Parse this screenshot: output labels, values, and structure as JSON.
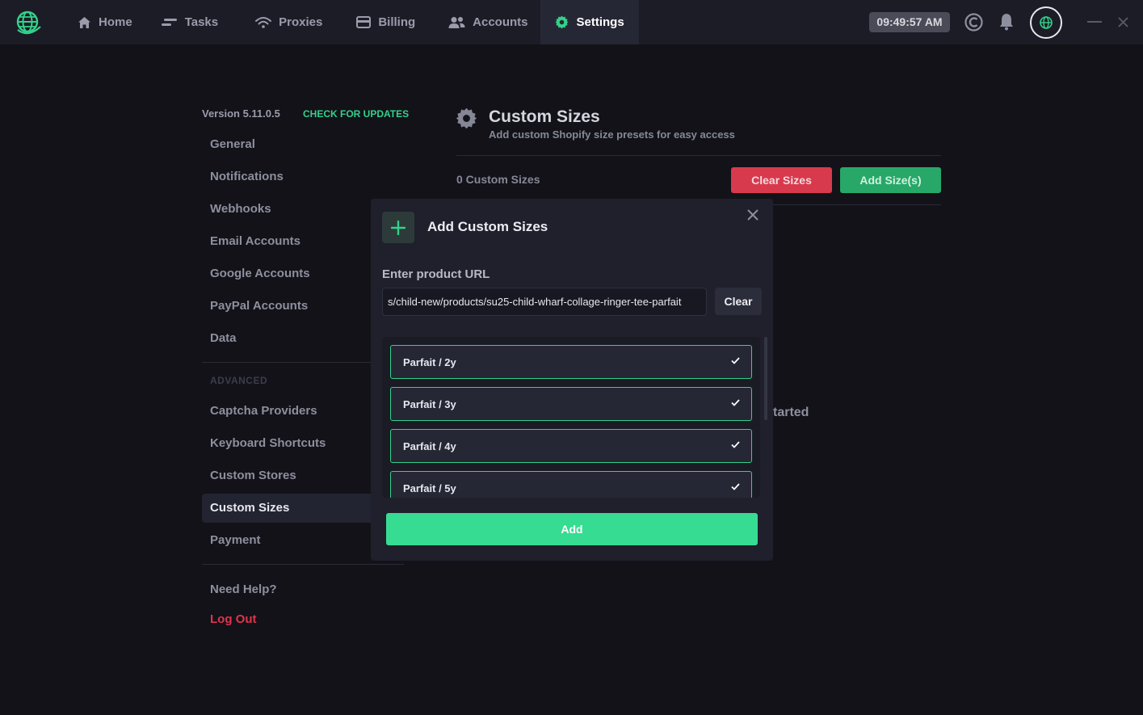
{
  "topbar": {
    "nav": [
      {
        "label": "Home",
        "icon": "home-icon"
      },
      {
        "label": "Tasks",
        "icon": "tasks-icon"
      },
      {
        "label": "Proxies",
        "icon": "wifi-icon"
      },
      {
        "label": "Billing",
        "icon": "card-icon"
      },
      {
        "label": "Accounts",
        "icon": "users-icon"
      },
      {
        "label": "Settings",
        "icon": "gear-icon",
        "active": true
      }
    ],
    "clock": "09:49:57 AM"
  },
  "sidebar": {
    "version": "Version 5.11.0.5",
    "check_updates": "CHECK FOR UPDATES",
    "items": [
      {
        "label": "General"
      },
      {
        "label": "Notifications"
      },
      {
        "label": "Webhooks"
      },
      {
        "label": "Email Accounts"
      },
      {
        "label": "Google Accounts"
      },
      {
        "label": "PayPal Accounts"
      },
      {
        "label": "Data"
      }
    ],
    "advanced_heading": "ADVANCED",
    "advanced_items": [
      {
        "label": "Captcha Providers"
      },
      {
        "label": "Keyboard Shortcuts"
      },
      {
        "label": "Custom Stores"
      },
      {
        "label": "Custom Sizes",
        "active": true
      },
      {
        "label": "Payment"
      }
    ],
    "help": "Need Help?",
    "logout": "Log Out"
  },
  "main": {
    "title": "Custom Sizes",
    "subtitle": "Add custom Shopify size presets for easy access",
    "count": "0 Custom Sizes",
    "clear_sizes": "Clear Sizes",
    "add_sizes": "Add Size(s)",
    "background_text": "tarted"
  },
  "modal": {
    "title": "Add Custom Sizes",
    "url_label": "Enter product URL",
    "url_value": "s/child-new/products/su25-child-wharf-collage-ringer-tee-parfait",
    "clear_label": "Clear",
    "sizes": [
      {
        "label": "Parfait / 2y",
        "checked": true
      },
      {
        "label": "Parfait / 3y",
        "checked": true
      },
      {
        "label": "Parfait / 4y",
        "checked": true
      },
      {
        "label": "Parfait / 5y",
        "checked": true
      }
    ],
    "add_label": "Add"
  },
  "colors": {
    "accent": "#33d18a",
    "danger": "#d83a4d",
    "background": "#121218",
    "topbar": "#1b1c26"
  }
}
